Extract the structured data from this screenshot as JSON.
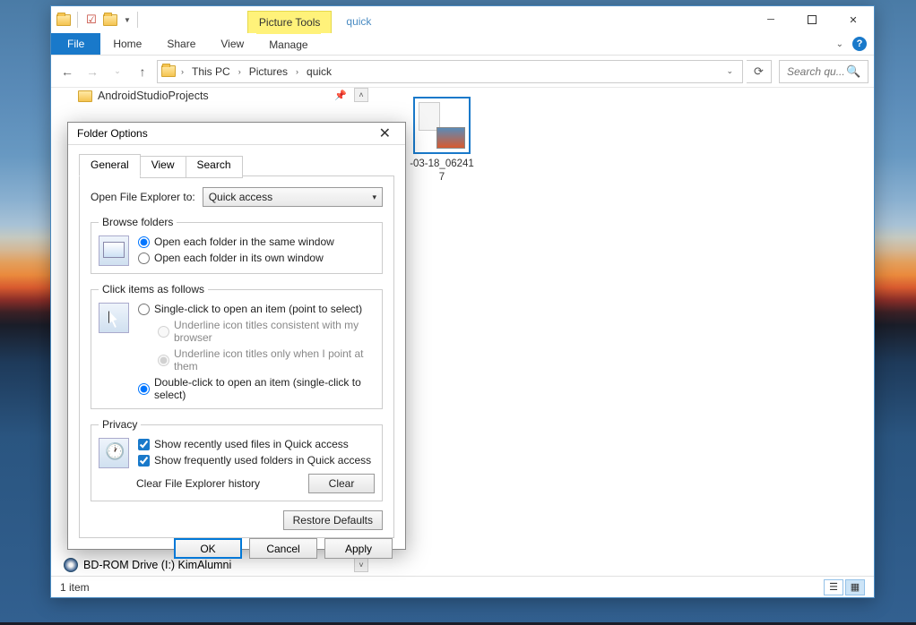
{
  "window": {
    "title": "quick",
    "context_tab": "Picture Tools"
  },
  "ribbon": {
    "file": "File",
    "home": "Home",
    "share": "Share",
    "view": "View",
    "manage": "Manage"
  },
  "address": {
    "seg1": "This PC",
    "seg2": "Pictures",
    "seg3": "quick"
  },
  "search": {
    "placeholder": "Search qu..."
  },
  "tree": {
    "item0": "AndroidStudioProjects",
    "bd": "BD-ROM Drive (I:) KimAlumni"
  },
  "file_item": {
    "name_line1": "-03-18_06241",
    "name_line2": "7"
  },
  "status": {
    "count": "1 item"
  },
  "dialog": {
    "title": "Folder Options",
    "tabs": {
      "general": "General",
      "view": "View",
      "search": "Search"
    },
    "open_to_label": "Open File Explorer to:",
    "open_to_value": "Quick access",
    "browse_legend": "Browse folders",
    "browse_same": "Open each folder in the same window",
    "browse_own": "Open each folder in its own window",
    "click_legend": "Click items as follows",
    "click_single": "Single-click to open an item (point to select)",
    "click_ul_browser": "Underline icon titles consistent with my browser",
    "click_ul_point": "Underline icon titles only when I point at them",
    "click_double": "Double-click to open an item (single-click to select)",
    "privacy_legend": "Privacy",
    "privacy_recent": "Show recently used files in Quick access",
    "privacy_frequent": "Show frequently used folders in Quick access",
    "clear_label": "Clear File Explorer history",
    "clear_btn": "Clear",
    "restore_btn": "Restore Defaults",
    "ok": "OK",
    "cancel": "Cancel",
    "apply": "Apply"
  }
}
